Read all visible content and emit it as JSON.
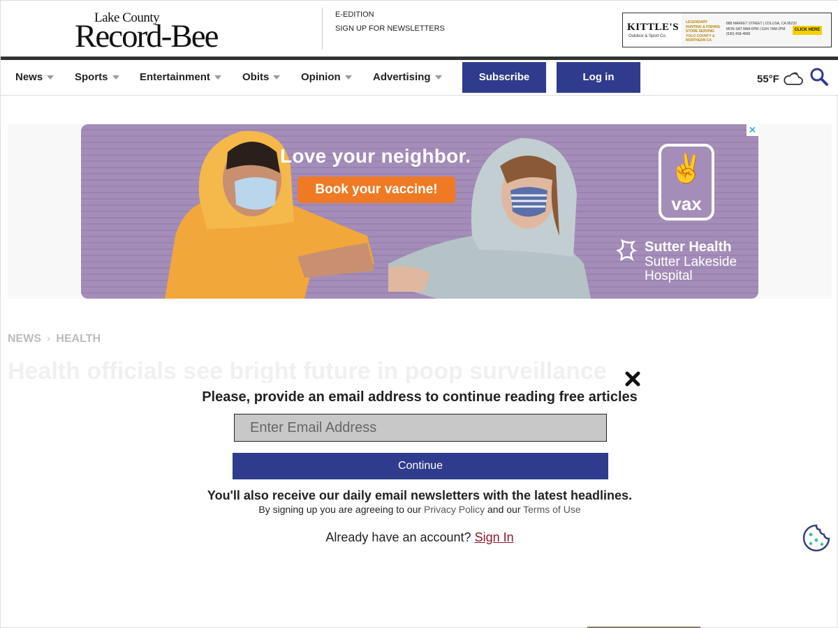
{
  "logo": {
    "small": "Lake County",
    "big": "Record-Bee"
  },
  "top_links": [
    "E-EDITION",
    "SIGN UP FOR NEWSLETTERS"
  ],
  "top_ad": {
    "brand": "KITTLE'S",
    "brand_sub": "Outdoor & Sport Co.",
    "mid": "LEGENDARY HUNTING & FISHING STORE SERVING YOLO COUNTY & NORTHERN CA",
    "info_line1": "888 MARKET STREET | COLUSA, CA 95232",
    "info_line2": "MON-SAT 8AM-6PM | SUN 7AM-2PM",
    "info_line3": "(530) 458-4868",
    "cta": "CLICK HERE"
  },
  "nav": {
    "items": [
      "News",
      "Sports",
      "Entertainment",
      "Obits",
      "Opinion",
      "Advertising"
    ],
    "subscribe": "Subscribe",
    "login": "Log in",
    "weather": "55°F",
    "weather_icon": "cloudy-icon",
    "search_icon": "search-icon"
  },
  "main_ad": {
    "headline": "Love your neighbor.",
    "cta": "Book your vaccine!",
    "badge": "vax",
    "sponsor_line1": "Sutter Health",
    "sponsor_line2": "Sutter Lakeside",
    "sponsor_line3": "Hospital",
    "close_glyph": "✕"
  },
  "breadcrumb": [
    "NEWS",
    "HEALTH"
  ],
  "article_title": "Health officials see bright future in poop surveillance",
  "modal": {
    "heading": "Please, provide an email address to continue reading free articles",
    "email_placeholder": "Enter Email Address",
    "continue": "Continue",
    "sub": "You'll also receive our daily email newsletters with the latest headlines.",
    "legal_prefix": "By signing up you are agreeing to our",
    "privacy": "Privacy Policy",
    "legal_mid": "and our",
    "terms": "Terms of Use",
    "account_prefix": "Already have an account?",
    "sign_in": "Sign In"
  },
  "colors": {
    "brand_blue": "#2f3b8c",
    "ad_purple": "#a58db9",
    "cta_orange": "#f07a24",
    "signin_red": "#8b1a2a"
  }
}
